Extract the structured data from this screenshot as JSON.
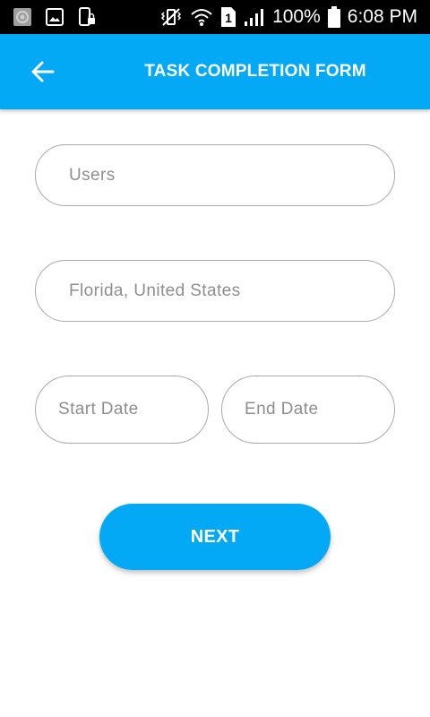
{
  "status_bar": {
    "battery": "100%",
    "time": "6:08 PM",
    "sim_slot": "1",
    "icons": [
      "app-notification-icon",
      "image-icon",
      "phone-lock-icon",
      "vibrate-mute-icon",
      "wifi-icon",
      "sim-icon",
      "signal-icon",
      "battery-icon"
    ]
  },
  "app_bar": {
    "title": "TASK COMPLETION FORM",
    "back_icon": "arrow-back-icon",
    "color": "#03a9f4"
  },
  "form": {
    "users_placeholder": "Users",
    "location_placeholder": "Florida, United States",
    "start_date_placeholder": "Start Date",
    "end_date_placeholder": "End Date",
    "next_label": "NEXT"
  },
  "colors": {
    "accent": "#03a9f4",
    "field_border": "#a9a9a9",
    "placeholder_text": "#8e8e8e"
  }
}
